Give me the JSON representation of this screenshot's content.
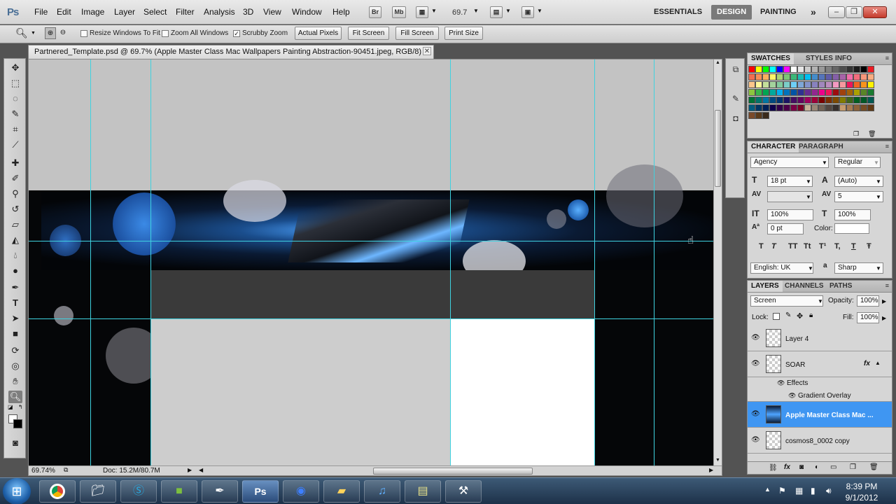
{
  "menubar": {
    "logo": "Ps",
    "items": [
      "File",
      "Edit",
      "Image",
      "Layer",
      "Select",
      "Filter",
      "Analysis",
      "3D",
      "View",
      "Window",
      "Help"
    ],
    "bridge_label": "Br",
    "minibridge_label": "Mb",
    "zoom_value": "69.7",
    "workspaces": [
      "ESSENTIALS",
      "DESIGN",
      "PAINTING"
    ],
    "more_label": "»"
  },
  "options": {
    "resize_windows": "Resize Windows To Fit",
    "zoom_all": "Zoom All Windows",
    "scrubby_zoom": "Scrubby Zoom",
    "scrubby_checked": "✓",
    "actual_pixels": "Actual Pixels",
    "fit_screen": "Fit Screen",
    "fill_screen": "Fill Screen",
    "print_size": "Print Size"
  },
  "document": {
    "tab_title": "Partnered_Template.psd @ 69.7% (Apple Master Class Mac Wallpapers Painting Abstraction-90451.jpeg, RGB/8) *",
    "zoom_percent": "69.74%",
    "doc_size": "Doc: 15.2M/80.7M"
  },
  "swatches_panel": {
    "tabs": [
      "SWATCHES",
      "STYLES",
      "INFO"
    ],
    "colors": [
      [
        "#ff0000",
        "#ffff00",
        "#00ff00",
        "#00ffff",
        "#0000ff",
        "#ff00ff",
        "#ffffff",
        "#e6e6e6",
        "#cccccc",
        "#b3b3b3",
        "#999999",
        "#808080",
        "#666666",
        "#4d4d4d",
        "#333333",
        "#1a1a1a",
        "#000000",
        "#ed1c24"
      ],
      [
        "#f26c4f",
        "#f68e56",
        "#fbaf5d",
        "#fff467",
        "#acd373",
        "#7cc576",
        "#3bb878",
        "#1abbb4",
        "#00bff3",
        "#438ccb",
        "#5574b9",
        "#605ca8",
        "#855fa8",
        "#a763a8",
        "#f06ea9",
        "#f26d7d",
        "#f7977a",
        "#f9ad81"
      ],
      [
        "#fdc68a",
        "#fff79a",
        "#c4df9b",
        "#a3d39c",
        "#82ca9d",
        "#7bcdc8",
        "#6ecff6",
        "#7ea7d8",
        "#8493ca",
        "#8882be",
        "#a187be",
        "#bc8dbf",
        "#f49ac2",
        "#f6989d",
        "#ed145b",
        "#f26522",
        "#f7941d",
        "#fff200"
      ],
      [
        "#8dc63f",
        "#39b54a",
        "#00a651",
        "#00a99d",
        "#00aeef",
        "#0072bc",
        "#0054a6",
        "#2e3192",
        "#662d91",
        "#92278f",
        "#ec008c",
        "#ed145b",
        "#9e0b0f",
        "#a0410d",
        "#a36209",
        "#aba000",
        "#598527",
        "#197b30"
      ],
      [
        "#007236",
        "#00746b",
        "#0076a3",
        "#004a80",
        "#003471",
        "#1b1464",
        "#440e62",
        "#630460",
        "#9e005d",
        "#9e0039",
        "#790000",
        "#7b2e00",
        "#7d4900",
        "#827b00",
        "#406618",
        "#005e20",
        "#005826",
        "#005952"
      ],
      [
        "#005b7f",
        "#003663",
        "#002157",
        "#0d004c",
        "#32004b",
        "#4b0049",
        "#7b0046",
        "#7a0026",
        "#c7b299",
        "#998675",
        "#736357",
        "#534741",
        "#37302d",
        "#c69c6d",
        "#a67c52",
        "#8c6239",
        "#754c24",
        "#603913"
      ],
      [
        "#7a4a2a",
        "#5a3a1a",
        "#3a2a1a"
      ]
    ]
  },
  "character_panel": {
    "tabs": [
      "CHARACTER",
      "PARAGRAPH"
    ],
    "font_family": "Agency",
    "font_style": "Regular",
    "font_size": "18 pt",
    "leading": "(Auto)",
    "kerning": "",
    "tracking": "5",
    "vertical_scale": "100%",
    "horizontal_scale": "100%",
    "baseline_shift": "0 pt",
    "color_label": "Color:",
    "language": "English: UK",
    "anti_alias_label": "a",
    "anti_alias": "Sharp",
    "style_buttons": [
      "T",
      "T",
      "TT",
      "Tt",
      "T¹",
      "T,",
      "T",
      "Ŧ"
    ]
  },
  "layers_panel": {
    "tabs": [
      "LAYERS",
      "CHANNELS",
      "PATHS"
    ],
    "blend_mode": "Screen",
    "opacity_label": "Opacity:",
    "opacity": "100%",
    "lock_label": "Lock:",
    "fill_label": "Fill:",
    "fill": "100%",
    "fx_label": "fx",
    "layers": [
      {
        "name": "Layer 4"
      },
      {
        "name": "SOAR"
      },
      {
        "name": "Effects"
      },
      {
        "name": "Gradient Overlay"
      },
      {
        "name": "Apple Master Class Mac ..."
      },
      {
        "name": "cosmos8_0002 copy"
      }
    ]
  },
  "taskbar": {
    "start_glyph": "⊞",
    "apps": [
      "Chrome",
      "Explorer",
      "Skype",
      "Minecraft",
      "Pen",
      "Photoshop",
      "Earth",
      "Folder",
      "iTunes",
      "Notes",
      "Tool"
    ],
    "ps_label": "Ps",
    "time": "8:39 PM",
    "date": "9/1/2012"
  }
}
